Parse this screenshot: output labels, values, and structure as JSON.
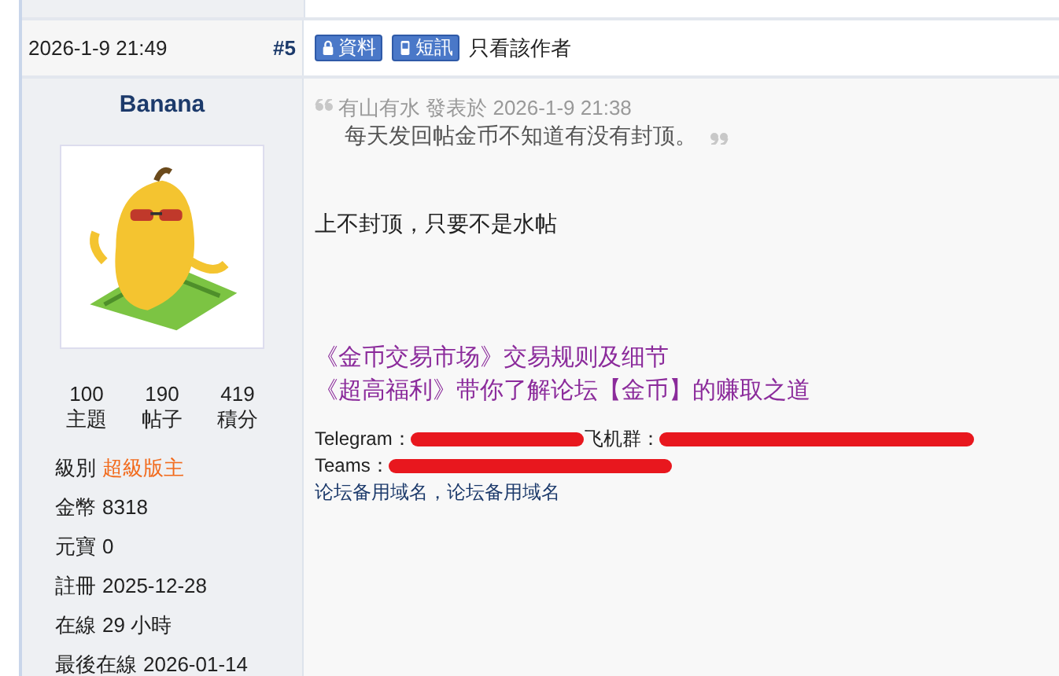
{
  "post_header": {
    "time": "2026-1-9 21:49",
    "floor": "#5",
    "buttons": [
      {
        "kind": "profile",
        "label": "資料"
      },
      {
        "kind": "message",
        "label": "短訊"
      }
    ],
    "author_only_link": "只看該作者"
  },
  "author": {
    "name": "Banana",
    "stats": [
      {
        "value": "100",
        "label": "主題"
      },
      {
        "value": "190",
        "label": "帖子"
      },
      {
        "value": "419",
        "label": "積分"
      }
    ],
    "info": [
      {
        "label": "級別",
        "value": "超級版主",
        "highlight": true
      },
      {
        "label": "金幣",
        "value": "8318",
        "highlight": false
      },
      {
        "label": "元寶",
        "value": "0",
        "highlight": false
      },
      {
        "label": "註冊",
        "value": "2025-12-28",
        "highlight": false
      },
      {
        "label": "在線",
        "value": "29 小時",
        "highlight": false
      },
      {
        "label": "最後在線",
        "value": "2026-01-14",
        "highlight": false
      }
    ]
  },
  "post": {
    "quote": {
      "meta": "有山有水 發表於 2026-1-9 21:38",
      "text": "每天发回帖金币不知道有没有封顶。"
    },
    "reply": "上不封顶，只要不是水帖",
    "links": [
      "《金币交易市场》交易规则及细节",
      "《超高福利》带你了解论坛【金币】的赚取之道"
    ],
    "contacts": [
      {
        "label": "Telegram：",
        "label_2": "飞机群："
      },
      {
        "label": "Teams："
      }
    ],
    "backup_domains": "论坛备用域名，论坛备用域名"
  }
}
